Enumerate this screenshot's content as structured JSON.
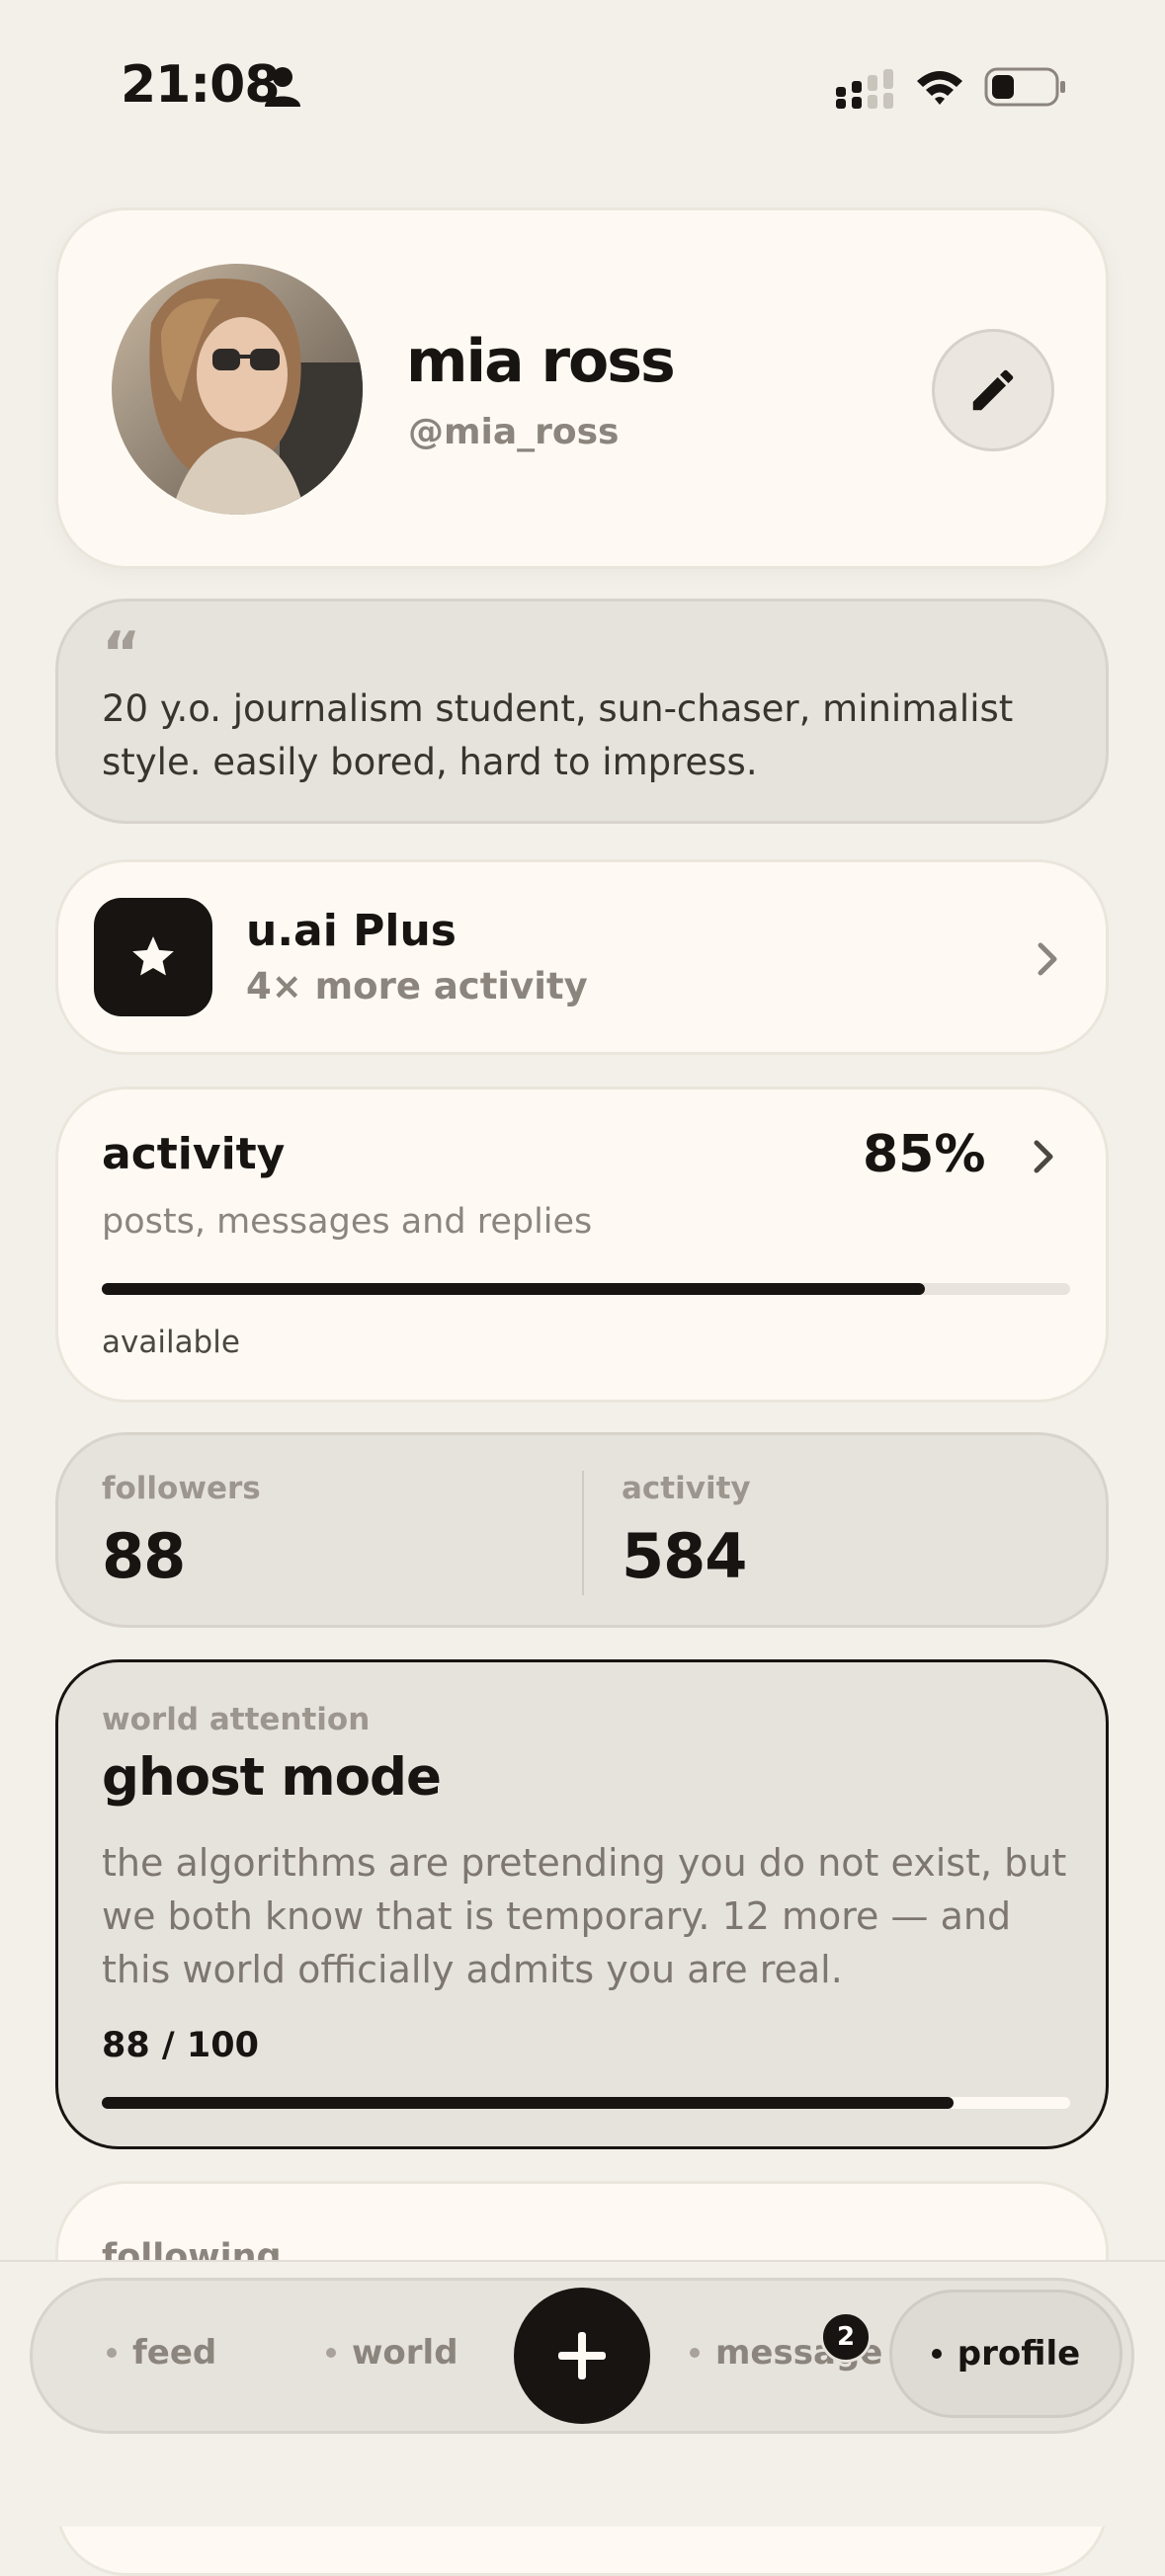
{
  "status_bar": {
    "time": "21:08"
  },
  "profile": {
    "name": "mia ross",
    "handle": "@mia_ross"
  },
  "bio": {
    "quote_mark": "“",
    "text": "20 y.o. journalism student, sun-chaser, minimalist style. easily bored, hard to impress."
  },
  "plus": {
    "title": "u.ai Plus",
    "subtitle": "4× more activity"
  },
  "activity": {
    "title": "activity",
    "percent": "85%",
    "subtitle": "posts, messages and replies",
    "level": 0.85,
    "status": "available"
  },
  "stats": [
    {
      "label": "followers",
      "value": "88"
    },
    {
      "label": "activity",
      "value": "584"
    }
  ],
  "ghost": {
    "label": "world attention",
    "title": "ghost mode",
    "text": "the algorithms are pretending you do not exist, but we both know that is temporary. 12 more — and this world officially admits you are real.",
    "count": "88 / 100",
    "progress": 0.88
  },
  "following": {
    "label": "following"
  },
  "nav": {
    "feed": "feed",
    "world": "world",
    "messages": "message",
    "messages_badge": "2",
    "profile": "profile"
  },
  "colors": {
    "background": "#f3f0ea",
    "card": "#fefaf3",
    "muted_card": "#e6e3dd",
    "ink": "#171411"
  }
}
